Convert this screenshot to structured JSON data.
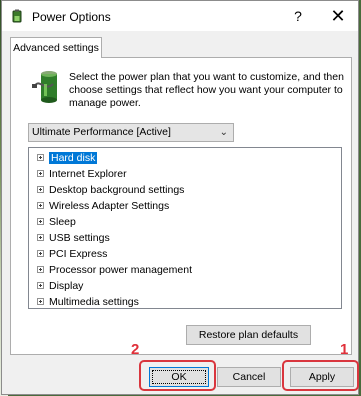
{
  "window": {
    "title": "Power Options",
    "help_glyph": "?",
    "close_glyph": "✕"
  },
  "tabs": [
    {
      "label": "Advanced settings"
    }
  ],
  "description": "Select the power plan that you want to customize, and then choose settings that reflect how you want your computer to manage power.",
  "plan_select": {
    "value": "Ultimate Performance [Active]"
  },
  "settings_tree": [
    {
      "label": "Hard disk",
      "selected": true
    },
    {
      "label": "Internet Explorer"
    },
    {
      "label": "Desktop background settings"
    },
    {
      "label": "Wireless Adapter Settings"
    },
    {
      "label": "Sleep"
    },
    {
      "label": "USB settings"
    },
    {
      "label": "PCI Express"
    },
    {
      "label": "Processor power management"
    },
    {
      "label": "Display"
    },
    {
      "label": "Multimedia settings"
    }
  ],
  "buttons": {
    "restore": "Restore plan defaults",
    "ok": "OK",
    "cancel": "Cancel",
    "apply": "Apply"
  },
  "annotations": {
    "step_ok": "2",
    "step_apply": "1",
    "highlight_color": "#d9363e"
  },
  "colors": {
    "selection": "#0078d7",
    "accent_border": "#0078d7"
  }
}
